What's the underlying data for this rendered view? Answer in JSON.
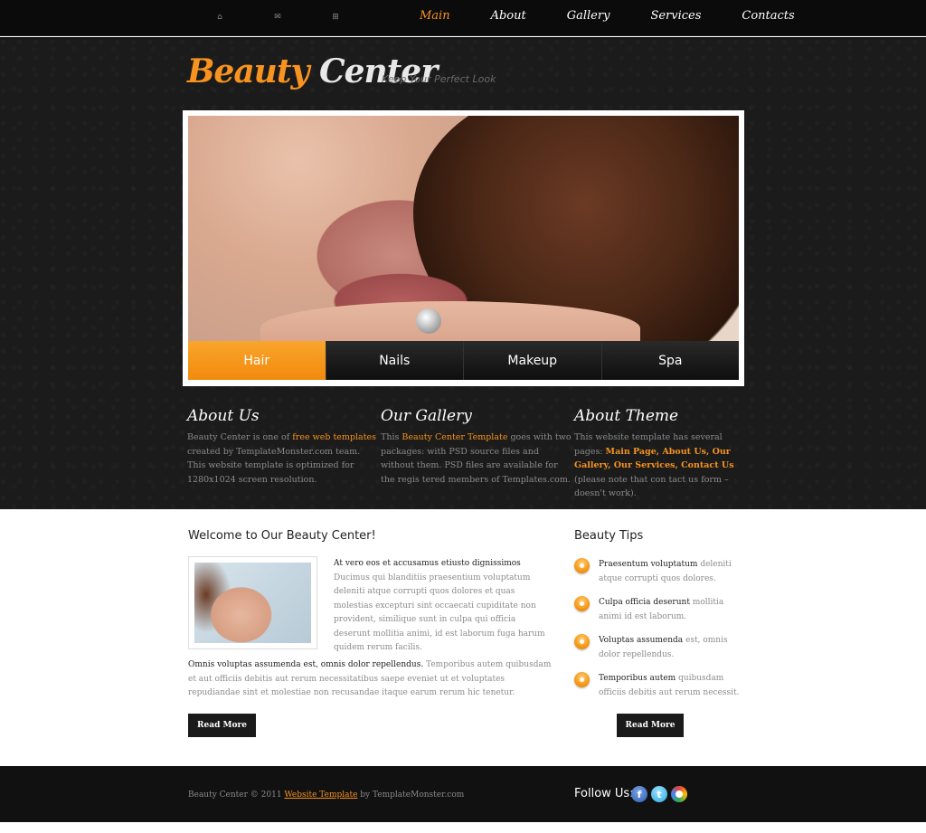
{
  "utility_icons": [
    {
      "name": "home-icon",
      "glyph": "⌂"
    },
    {
      "name": "mail-icon",
      "glyph": "✉"
    },
    {
      "name": "sitemap-icon",
      "glyph": "⊞"
    }
  ],
  "nav": {
    "items": [
      "Main",
      "About",
      "Gallery",
      "Services",
      "Contacts"
    ],
    "active": "Main"
  },
  "logo": {
    "part1": "Beauty",
    "part2": "Center"
  },
  "tagline": "Keep Your Perfect Look",
  "slider": {
    "tabs": [
      "Hair",
      "Nails",
      "Makeup",
      "Spa"
    ],
    "active_tab": "Hair"
  },
  "columns": [
    {
      "title": "About Us",
      "t1": "Beauty Center is one of ",
      "link": "free web templates",
      "t2": " created by TemplateMonster.com team. This website template is optimized for 1280x1024 screen resolution."
    },
    {
      "title": "Our Gallery",
      "t1": "This ",
      "link": "Beauty Center Template",
      "t2": " goes with two packages: with PSD source files and without them. PSD files are available for the regis tered members of Templates.com."
    },
    {
      "title": "About Theme",
      "t1": "This website template has several pages: ",
      "link": "Main Page, About Us, Our Gallery, Our Services, Contact Us",
      "t2": " (please note that con tact us form – doesn't work)."
    }
  ],
  "welcome": {
    "title": "Welcome to Our Beauty Center!",
    "intro_lead": "At vero eos et accusamus etiusto dignissimos",
    "intro_text": "Ducimus qui blanditiis praesentium voluptatum deleniti atque corrupti quos dolores et quas molestias excepturi sint occaecati cupiditate non provident, similique sunt in culpa qui officia deserunt mollitia animi, id est laborum fuga harum quidem rerum facilis.",
    "para_lead": "Omnis voluptas assumenda est, omnis dolor repellendus.",
    "para_text": " Temporibus autem quibusdam et aut officiis debitis aut rerum necessitatibus saepe eveniet ut et voluptates repudiandae sint et molestiae non recusandae itaque earum rerum hic tenetur.",
    "button": "Read More"
  },
  "tips": {
    "title": "Beauty Tips",
    "items": [
      {
        "lead": "Praesentum voluptatum",
        "text": " deleniti atque corrupti quos dolores."
      },
      {
        "lead": "Culpa officia deserunt",
        "text": " mollitia animi id est laborum."
      },
      {
        "lead": "Voluptas assumenda",
        "text": " est, omnis dolor repellendus."
      },
      {
        "lead": "Temporibus autem",
        "text": " quibusdam officiis debitis aut rerum necessit."
      }
    ],
    "button": "Read More"
  },
  "footer": {
    "copy_before": "Beauty Center © 2011 ",
    "copy_link": "Website Template",
    "copy_after": " by TemplateMonster.com",
    "follow_label": "Follow Us:",
    "social": [
      {
        "name": "facebook-icon",
        "glyph": "f"
      },
      {
        "name": "twitter-icon",
        "glyph": "t"
      },
      {
        "name": "picasa-icon",
        "glyph": ""
      }
    ]
  },
  "colors": {
    "accent": "#f7931e",
    "dark_bg": "#1b1b1b",
    "footer_bg": "#111111"
  }
}
